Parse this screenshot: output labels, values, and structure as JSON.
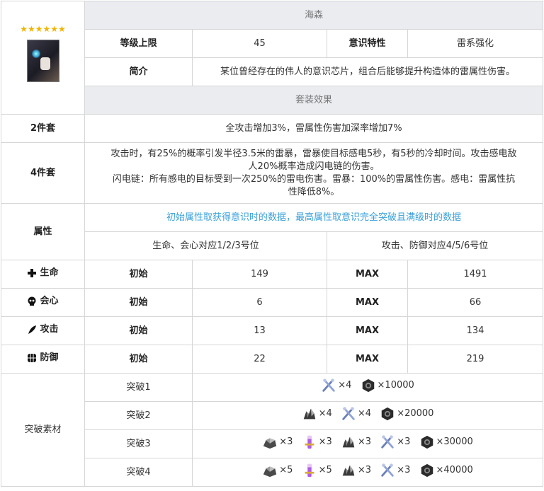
{
  "rating": "★★★★★★",
  "name": "海森",
  "row_level": {
    "label": "等级上限",
    "value": "45",
    "trait_label": "意识特性",
    "trait_value": "雷系强化"
  },
  "row_intro": {
    "label": "简介",
    "text": "某位曾经存在的伟人的意识芯片，组合后能够提升构造体的雷属性伤害。"
  },
  "set_header": "套装效果",
  "set2": {
    "label": "2件套",
    "text": "全攻击增加3%，雷属性伤害加深率增加7%"
  },
  "set4": {
    "label": "4件套",
    "line1": "攻击时，有25%的概率引发半径3.5米的雷暴，雷暴使目标感电5秒，有5秒的冷却时间。攻击感电敌",
    "line2": "人20%概率造成闪电链的伤害。",
    "line3": "闪电链：所有感电的目标受到一次250%的雷电伤害。雷暴：100%的雷属性伤害。感电：雷属性抗",
    "line4": "性降低8%。"
  },
  "attr": {
    "label": "属性",
    "note": "初始属性取获得意识时的数据，最高属性取意识完全突破且满级时的数据",
    "sub_left": "生命、会心对应1/2/3号位",
    "sub_right": "攻击、防御对应4/5/6号位"
  },
  "stats": [
    {
      "icon": "cross-icon",
      "label": "生命",
      "init_label": "初始",
      "init": "149",
      "max_label": "MAX",
      "max": "1491"
    },
    {
      "icon": "skull-icon",
      "label": "会心",
      "init_label": "初始",
      "init": "6",
      "max_label": "MAX",
      "max": "66"
    },
    {
      "icon": "feather-icon",
      "label": "攻击",
      "init_label": "初始",
      "init": "13",
      "max_label": "MAX",
      "max": "134"
    },
    {
      "icon": "shield-grid-icon",
      "label": "防御",
      "init_label": "初始",
      "init": "22",
      "max_label": "MAX",
      "max": "219"
    }
  ],
  "breakthrough": {
    "label": "突破素材",
    "rows": [
      {
        "label": "突破1",
        "items": [
          {
            "icon": "wrench-icon",
            "qty": "×4"
          },
          {
            "icon": "nut-icon",
            "qty": "×10000"
          }
        ]
      },
      {
        "label": "突破2",
        "items": [
          {
            "icon": "ore-icon",
            "qty": "×4"
          },
          {
            "icon": "wrench-icon",
            "qty": "×4"
          },
          {
            "icon": "nut-icon",
            "qty": "×20000"
          }
        ]
      },
      {
        "label": "突破3",
        "items": [
          {
            "icon": "gear-ore-icon",
            "qty": "×3"
          },
          {
            "icon": "vial-icon",
            "qty": "×3"
          },
          {
            "icon": "ore-icon",
            "qty": "×3"
          },
          {
            "icon": "wrench-icon",
            "qty": "×3"
          },
          {
            "icon": "nut-icon",
            "qty": "×30000"
          }
        ]
      },
      {
        "label": "突破4",
        "items": [
          {
            "icon": "gear-ore-icon",
            "qty": "×5"
          },
          {
            "icon": "vial-icon",
            "qty": "×5"
          },
          {
            "icon": "ore-icon",
            "qty": "×3"
          },
          {
            "icon": "wrench-icon",
            "qty": "×3"
          },
          {
            "icon": "nut-icon",
            "qty": "×40000"
          }
        ]
      }
    ]
  },
  "colors": {
    "header_bg": "#eaecf0",
    "note": "#3aa0d8",
    "star": "#f0b400"
  }
}
